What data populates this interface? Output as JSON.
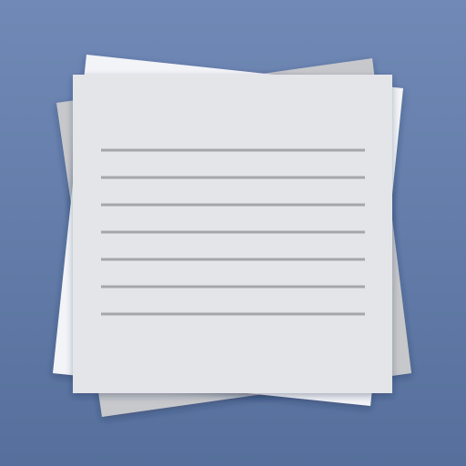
{
  "app_icon": {
    "icon_name": "notes-paper-stack-icon",
    "colors": {
      "background_top": "#7089b6",
      "background_bottom": "#566f9c",
      "back_sheet": "#c7c8cb",
      "middle_sheet": "#f3f4f7",
      "front_sheet": "#e4e5e9",
      "lines": "#a5a6a9"
    },
    "sheet_count": 3,
    "ruled_line_count": 7
  }
}
